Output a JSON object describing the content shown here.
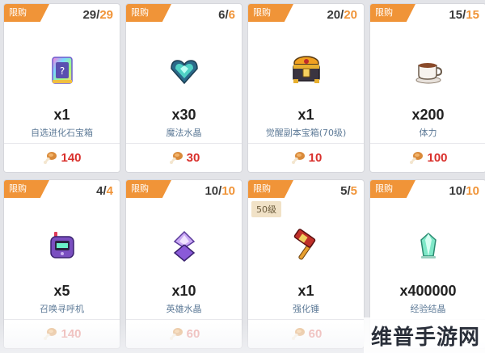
{
  "shop": {
    "tag_label": "限购",
    "items": [
      {
        "purchased": "29",
        "limit": "29",
        "icon": "selector-evolution-stone-chest-icon",
        "quantity": "x1",
        "name": "自选进化石宝箱",
        "price": "140",
        "level": ""
      },
      {
        "purchased": "6",
        "limit": "6",
        "icon": "magic-crystal-icon",
        "quantity": "x30",
        "name": "魔法水晶",
        "price": "30",
        "level": ""
      },
      {
        "purchased": "20",
        "limit": "20",
        "icon": "awakening-dungeon-chest-icon",
        "quantity": "x1",
        "name": "觉醒副本宝箱(70级)",
        "price": "10",
        "level": ""
      },
      {
        "purchased": "15",
        "limit": "15",
        "icon": "coffee-cup-stamina-icon",
        "quantity": "x200",
        "name": "体力",
        "price": "100",
        "level": ""
      },
      {
        "purchased": "4",
        "limit": "4",
        "icon": "summon-pager-icon",
        "quantity": "x5",
        "name": "召唤寻呼机",
        "price": "140",
        "level": ""
      },
      {
        "purchased": "10",
        "limit": "10",
        "icon": "hero-crystal-icon",
        "quantity": "x10",
        "name": "英雄水晶",
        "price": "60",
        "level": ""
      },
      {
        "purchased": "5",
        "limit": "5",
        "icon": "enhancement-hammer-icon",
        "quantity": "x1",
        "name": "强化锤",
        "price": "60",
        "level": "50级"
      },
      {
        "purchased": "10",
        "limit": "10",
        "icon": "experience-crystal-icon",
        "quantity": "x400000",
        "name": "经验结晶",
        "price": "60",
        "level": ""
      }
    ],
    "currency_icon": "drumstick-icon"
  },
  "watermark": {
    "text": "维普手游网"
  },
  "colors": {
    "tag": "#f09438",
    "price": "#d9302c",
    "name": "#5d7a97",
    "limit_max": "#f09438"
  }
}
